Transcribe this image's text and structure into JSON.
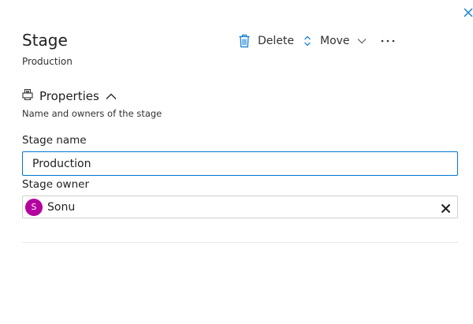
{
  "panel": {
    "title": "Stage",
    "subtitle": "Production"
  },
  "toolbar": {
    "delete_label": "Delete",
    "move_label": "Move",
    "more_label": "···"
  },
  "properties": {
    "heading": "Properties",
    "description": "Name and owners of the stage"
  },
  "fields": {
    "stage_name_label": "Stage name",
    "stage_name_value": "Production",
    "stage_owner_label": "Stage owner"
  },
  "owner": {
    "initial": "S",
    "name": "Sonu",
    "avatar_color": "#b4009e"
  },
  "colors": {
    "accent": "#0078d4",
    "icon": "#0078d4"
  },
  "icons": {
    "close": "close-icon",
    "delete": "trash-icon",
    "move": "up-down-arrows-icon",
    "move_menu": "chevron-down-icon",
    "more": "more-ellipsis-icon",
    "properties": "printer-icon",
    "collapse": "chevron-up-icon",
    "clear": "clear-x-icon"
  }
}
